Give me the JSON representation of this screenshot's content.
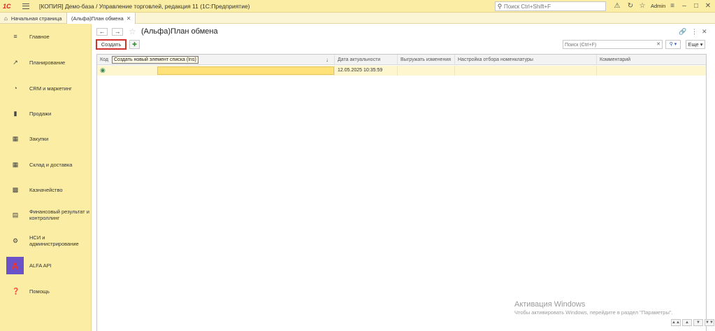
{
  "titlebar": {
    "logo": "1С",
    "title": "[КОПИЯ] Демо-база / Управление торговлей, редакция 11  (1С:Предприятие)",
    "search_placeholder": "Поиск Ctrl+Shift+F",
    "user": "Admin"
  },
  "tabs": [
    {
      "label": "Начальная страница"
    },
    {
      "label": "(Альфа)План обмена"
    }
  ],
  "sidebar": {
    "items": [
      {
        "label": "Главное"
      },
      {
        "label": "Планирование"
      },
      {
        "label": "CRM и маркетинг"
      },
      {
        "label": "Продажи"
      },
      {
        "label": "Закупки"
      },
      {
        "label": "Склад и доставка"
      },
      {
        "label": "Казначейство"
      },
      {
        "label": "Финансовый результат и контроллинг"
      },
      {
        "label": "НСИ и администрирование"
      },
      {
        "label": "ALFA API"
      },
      {
        "label": "Помощь"
      }
    ]
  },
  "form": {
    "title": "(Альфа)План обмена",
    "create_label": "Создать",
    "search_placeholder": "Поиск (Ctrl+F)",
    "more_label": "Еще"
  },
  "grid": {
    "columns": [
      "Код",
      "Дата актуальности",
      "Выгружать изменения",
      "Настройка отбора номенклатуры",
      "Комментарий"
    ],
    "tooltip": "Создать новый элемент списка (Ins)",
    "rows": [
      {
        "code": "",
        "name": "",
        "date": "12.05.2025 10:35:59",
        "export": "",
        "filter": "",
        "comment": ""
      }
    ]
  },
  "watermark": {
    "title": "Активация Windows",
    "subtitle": "Чтобы активировать Windows, перейдите в раздел \"Параметры\"."
  }
}
